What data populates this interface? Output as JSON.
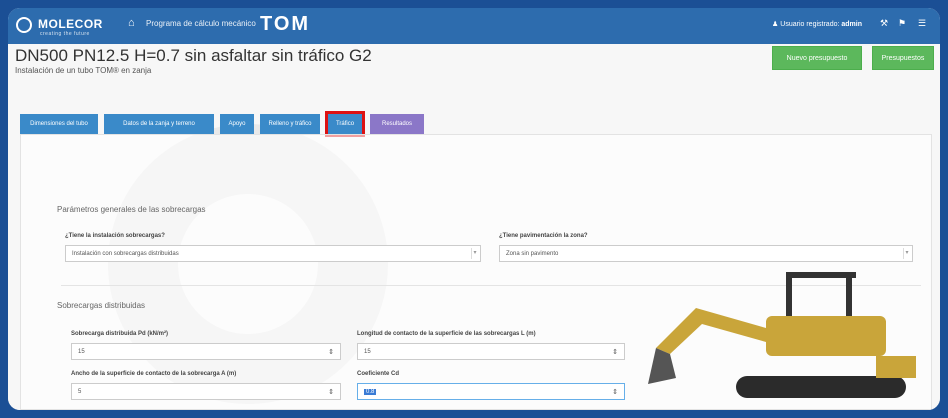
{
  "header": {
    "brand": "MOLECOR",
    "brand_tagline": "creating the future",
    "program_label": "Programa de cálculo mecánico",
    "product": "TOM",
    "user_prefix": "Usuario registrado:",
    "user_name": "admin",
    "icons": [
      "home-icon",
      "user-icon",
      "tools-icon",
      "flag-icon",
      "menu-icon"
    ]
  },
  "page": {
    "title": "DN500 PN12.5 H=0.7 sin asfaltar sin tráfico G2",
    "subtitle": "Instalación de un tubo TOM® en zanja",
    "btn_primary": "Nuevo presupuesto",
    "btn_secondary": "Presupuestos"
  },
  "tabs": [
    {
      "label": "Dimensiones del tubo"
    },
    {
      "label": "Datos de la zanja y terreno"
    },
    {
      "label": "Apoyo"
    },
    {
      "label": "Relleno y tráfico"
    },
    {
      "label": "Tráfico"
    },
    {
      "label": "Resultados"
    }
  ],
  "general": {
    "section_title": "Parámetros generales de las sobrecargas",
    "q1_label": "¿Tiene la instalación sobrecargas?",
    "q1_value": "Instalación con sobrecargas distribuidas",
    "q2_label": "¿Tiene pavimentación la zona?",
    "q2_value": "Zona sin pavimento"
  },
  "distributed": {
    "section_title": "Sobrecargas distribuidas",
    "f1_label": "Sobrecarga distribuida Pd (kN/m²)",
    "f1_value": "15",
    "f2_label": "Longitud de contacto de la superficie de las sobrecargas L (m)",
    "f2_value": "15",
    "f3_label": "Ancho de la superficie de contacto de la sobrecarga A (m)",
    "f3_value": "5",
    "f4_label": "Coeficiente Cd",
    "f4_value": "0.8"
  },
  "colors": {
    "header": "#2d6cae",
    "tab": "#3a8ac9",
    "tab_active": "#8b77c8",
    "highlight": "#dd1111",
    "green": "#5cb85c",
    "excavator": "#c9a53a"
  }
}
